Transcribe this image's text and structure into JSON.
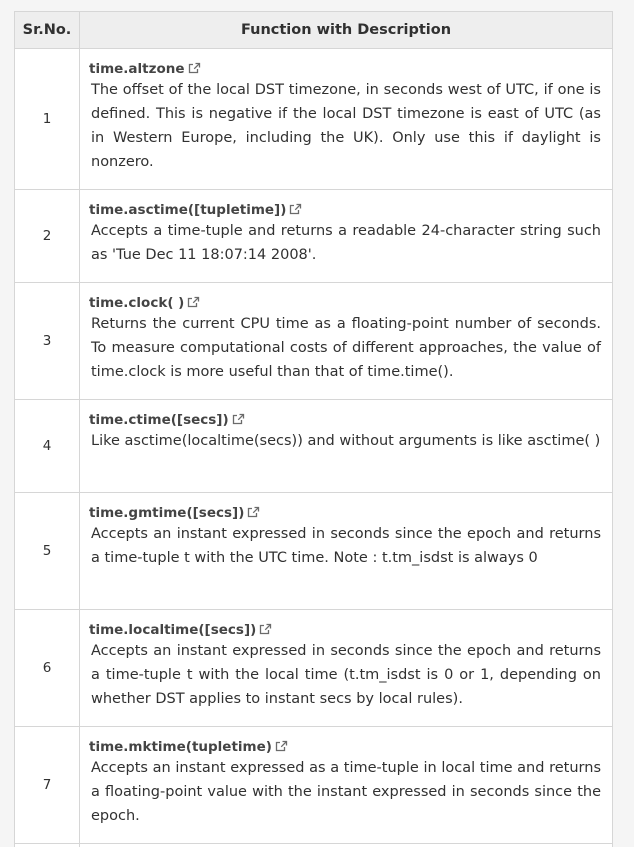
{
  "header": {
    "col1": "Sr.No.",
    "col2": "Function with Description"
  },
  "rows": [
    {
      "num": "1",
      "name": "time.altzone",
      "desc": "The offset of the local DST timezone, in seconds west of UTC, if one is defined. This is negative if the local DST timezone is east of UTC (as in Western Europe, including the UK). Only use this if daylight is nonzero."
    },
    {
      "num": "2",
      "name": "time.asctime([tupletime])",
      "desc": "Accepts a time-tuple and returns a readable 24-character string such as 'Tue Dec 11 18:07:14 2008'."
    },
    {
      "num": "3",
      "name": "time.clock( )",
      "desc": "Returns the current CPU time as a floating-point number of seconds. To measure computational costs of different approaches, the value of time.clock is more useful than that of time.time()."
    },
    {
      "num": "4",
      "name": "time.ctime([secs])",
      "desc": "Like asctime(localtime(secs)) and without arguments is like asctime( )"
    },
    {
      "num": "5",
      "name": "time.gmtime([secs])",
      "desc": "Accepts an instant expressed in seconds since the epoch and returns a time-tuple t with the UTC time. Note : t.tm_isdst is always 0"
    },
    {
      "num": "6",
      "name": "time.localtime([secs])",
      "desc": "Accepts an instant expressed in seconds since the epoch and returns a time-tuple t with the local time (t.tm_isdst is 0 or 1, depending on whether DST applies to instant secs by local rules)."
    },
    {
      "num": "7",
      "name": "time.mktime(tupletime)",
      "desc": "Accepts an instant expressed as a time-tuple in local time and returns a floating-point value with the instant expressed in seconds since the epoch."
    }
  ],
  "icons": {
    "external_link": "external-link-icon"
  },
  "colors": {
    "header_bg": "#eeeeee",
    "border": "#d6d6d6",
    "text": "#313131"
  }
}
